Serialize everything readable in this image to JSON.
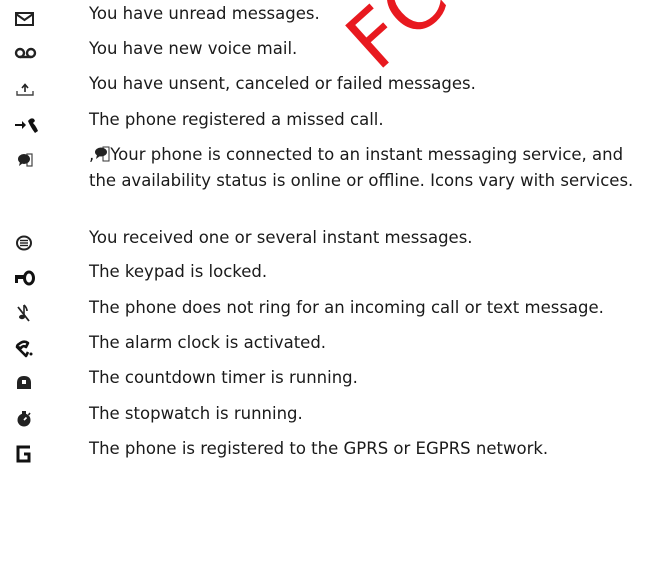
{
  "watermark": "FCC Draft",
  "indicators": [
    {
      "icon": "envelope-icon",
      "text": "You have unread messages."
    },
    {
      "icon": "voicemail-icon",
      "text": "You have new voice mail."
    },
    {
      "icon": "outbox-icon",
      "text": "You have unsent, canceled or failed messages."
    },
    {
      "icon": "missed-call-icon",
      "text": "The phone registered a missed call."
    },
    {
      "icon": "im-status-icon",
      "prefix": ",",
      "text": "Your phone is connected to an instant messaging service, and the availability status is online or offline. Icons vary with services."
    },
    {
      "icon": "instant-message-icon",
      "text": "You received one or several instant messages."
    },
    {
      "icon": "keypad-lock-icon",
      "text": "The keypad is locked."
    },
    {
      "icon": "silent-icon",
      "text": "The phone does not ring for an incoming call or text message."
    },
    {
      "icon": "alarm-clock-icon",
      "text": "The alarm clock is activated."
    },
    {
      "icon": "countdown-timer-icon",
      "text": "The countdown timer is running."
    },
    {
      "icon": "stopwatch-icon",
      "text": "The stopwatch is running."
    },
    {
      "icon": "gprs-icon",
      "text": "The phone is registered to the GPRS or EGPRS network."
    }
  ]
}
